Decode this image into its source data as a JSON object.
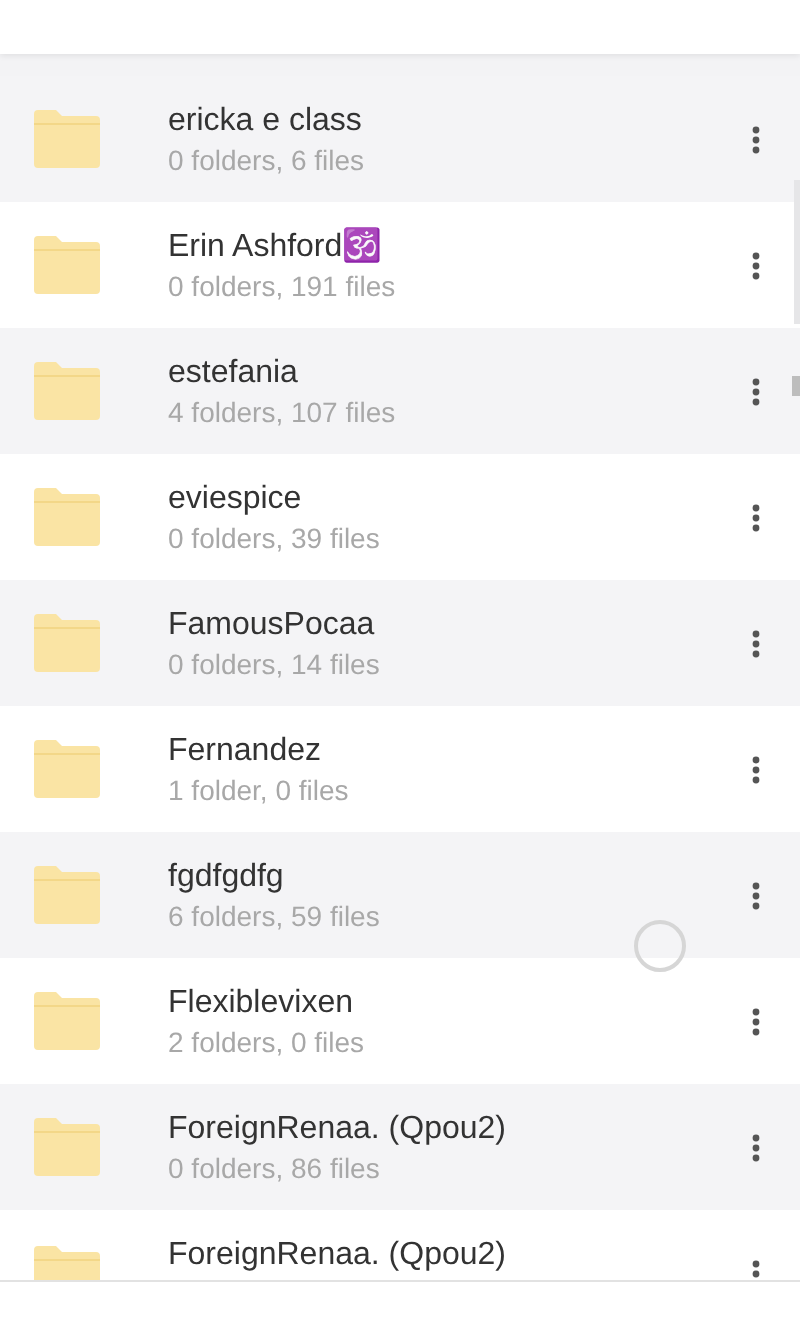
{
  "folders": [
    {
      "name": "ericka e class",
      "details": "0 folders, 6 files"
    },
    {
      "name": "Erin Ashford🕉️",
      "details": "0 folders, 191 files"
    },
    {
      "name": "estefania",
      "details": "4 folders, 107 files"
    },
    {
      "name": "eviespice",
      "details": "0 folders, 39 files"
    },
    {
      "name": "FamousPocaa",
      "details": "0 folders, 14 files"
    },
    {
      "name": "Fernandez",
      "details": "1 folder, 0 files"
    },
    {
      "name": "fgdfgdfg",
      "details": "6 folders, 59 files"
    },
    {
      "name": "Flexiblevixen",
      "details": "2 folders, 0 files"
    },
    {
      "name": "ForeignRenaa. (Qpou2)",
      "details": "0 folders, 86 files"
    },
    {
      "name": "ForeignRenaa. (Qpou2)"
    }
  ]
}
